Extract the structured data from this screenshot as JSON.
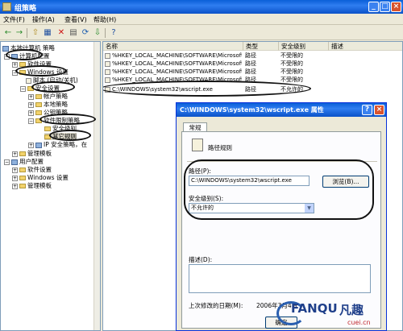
{
  "window": {
    "title": "组策略",
    "min_glyph": "_",
    "max_glyph": "□",
    "close_glyph": "×"
  },
  "menu": {
    "file": "文件(F)",
    "action": "操作(A)",
    "view": "查看(V)",
    "help": "帮助(H)"
  },
  "toolbar": {
    "back": "←",
    "forward": "→",
    "up": "⇧",
    "show": "▦",
    "delete": "✕",
    "props": "▤",
    "refresh": "⟳",
    "export": "⇩",
    "help": "?"
  },
  "tree": {
    "root": "本地计算机 策略",
    "computer_config": "计算机配置",
    "software_settings": "软件设置",
    "windows_settings": "Windows 设置",
    "scripts": "脚本 (启动/关机)",
    "security_settings": "安全设置",
    "account_policies": "帐户策略",
    "local_policies": "本地策略",
    "public_key": "公钥策略",
    "software_restriction": "软件限制策略",
    "security_levels": "安全级别",
    "other_rules": "其它规则",
    "ip_security": "IP 安全策略，在",
    "admin_templates": "管理模板",
    "user_config": "用户配置",
    "u_software": "软件设置",
    "u_windows": "Windows 设置",
    "u_admin": "管理模板"
  },
  "list": {
    "headers": {
      "name": "名称",
      "type": "类型",
      "level": "安全级别",
      "desc": "描述"
    },
    "rows": [
      {
        "name": "%HKEY_LOCAL_MACHINE\\SOFTWARE\\Microsoft\\...",
        "type": "路径",
        "level": "不受限的"
      },
      {
        "name": "%HKEY_LOCAL_MACHINE\\SOFTWARE\\Microsoft\\...",
        "type": "路径",
        "level": "不受限的"
      },
      {
        "name": "%HKEY_LOCAL_MACHINE\\SOFTWARE\\Microsoft\\...",
        "type": "路径",
        "level": "不受限的"
      },
      {
        "name": "%HKEY_LOCAL_MACHINE\\SOFTWARE\\Microsoft\\...",
        "type": "路径",
        "level": "不受限的"
      },
      {
        "name": "C:\\WINDOWS\\system32\\wscript.exe",
        "type": "路径",
        "level": "不允许的"
      }
    ]
  },
  "dialog": {
    "title": "C:\\WINDOWS\\system32\\wscript.exe 属性",
    "help_glyph": "?",
    "close_glyph": "×",
    "tab": "常规",
    "rule_name": "路径规则",
    "path_label": "路径(P):",
    "path_value": "C:\\WINDOWS\\system32\\wscript.exe",
    "browse": "浏览(B)...",
    "level_label": "安全级别(S):",
    "level_value": "不允许的",
    "desc_label": "描述(D):",
    "modified_label": "上次修改的日期(M):",
    "modified_value": "2006年3月4日",
    "ok": "确定"
  },
  "watermark": {
    "brand": "FANQU",
    "cn": "凡趣",
    "url": "cuei.cn"
  }
}
